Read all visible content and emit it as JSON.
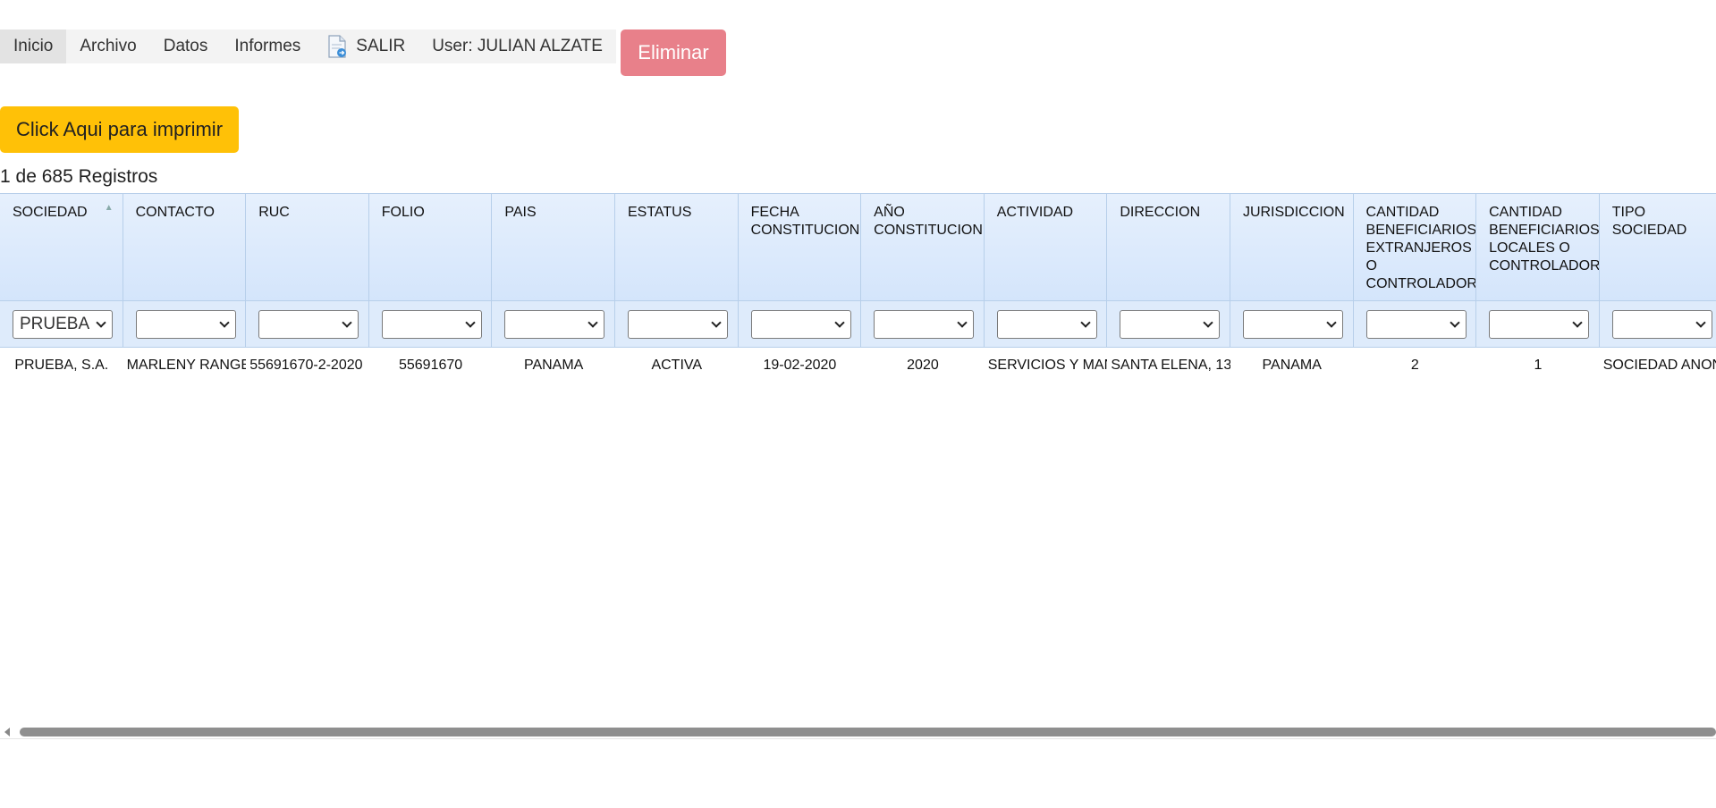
{
  "menu": {
    "inicio": "Inicio",
    "archivo": "Archivo",
    "datos": "Datos",
    "informes": "Informes",
    "salir": "SALIR",
    "user": "User: JULIAN ALZATE"
  },
  "actions": {
    "eliminar": "Eliminar",
    "imprimir": "Click Aqui para imprimir"
  },
  "record_count": "1 de 685 Registros",
  "grid": {
    "columns": [
      "SOCIEDAD",
      "CONTACTO",
      "RUC",
      "FOLIO",
      "PAIS",
      "ESTATUS",
      "FECHA CONSTITUCION",
      "AÑO CONSTITUCION",
      "ACTIVIDAD",
      "DIRECCION",
      "JURISDICCION",
      "CANTIDAD BENEFICIARIOS EXTRANJEROS O CONTROLADORES",
      "CANTIDAD BENEFICIARIOS LOCALES O CONTROLADORES",
      "TIPO SOCIEDAD"
    ],
    "filters": [
      "PRUEBA, S.A.",
      "",
      "",
      "",
      "",
      "",
      "",
      "",
      "",
      "",
      "",
      "",
      "",
      ""
    ],
    "rows": [
      [
        "PRUEBA, S.A.",
        "MARLENY RANGEL",
        "55691670-2-2020",
        "55691670",
        "PANAMA",
        "ACTIVA",
        "19-02-2020",
        "2020",
        "SERVICIOS Y MANTENIMIENTO",
        "SANTA ELENA, 13",
        "PANAMA",
        "2",
        "1",
        "SOCIEDAD ANONIMA"
      ]
    ]
  }
}
